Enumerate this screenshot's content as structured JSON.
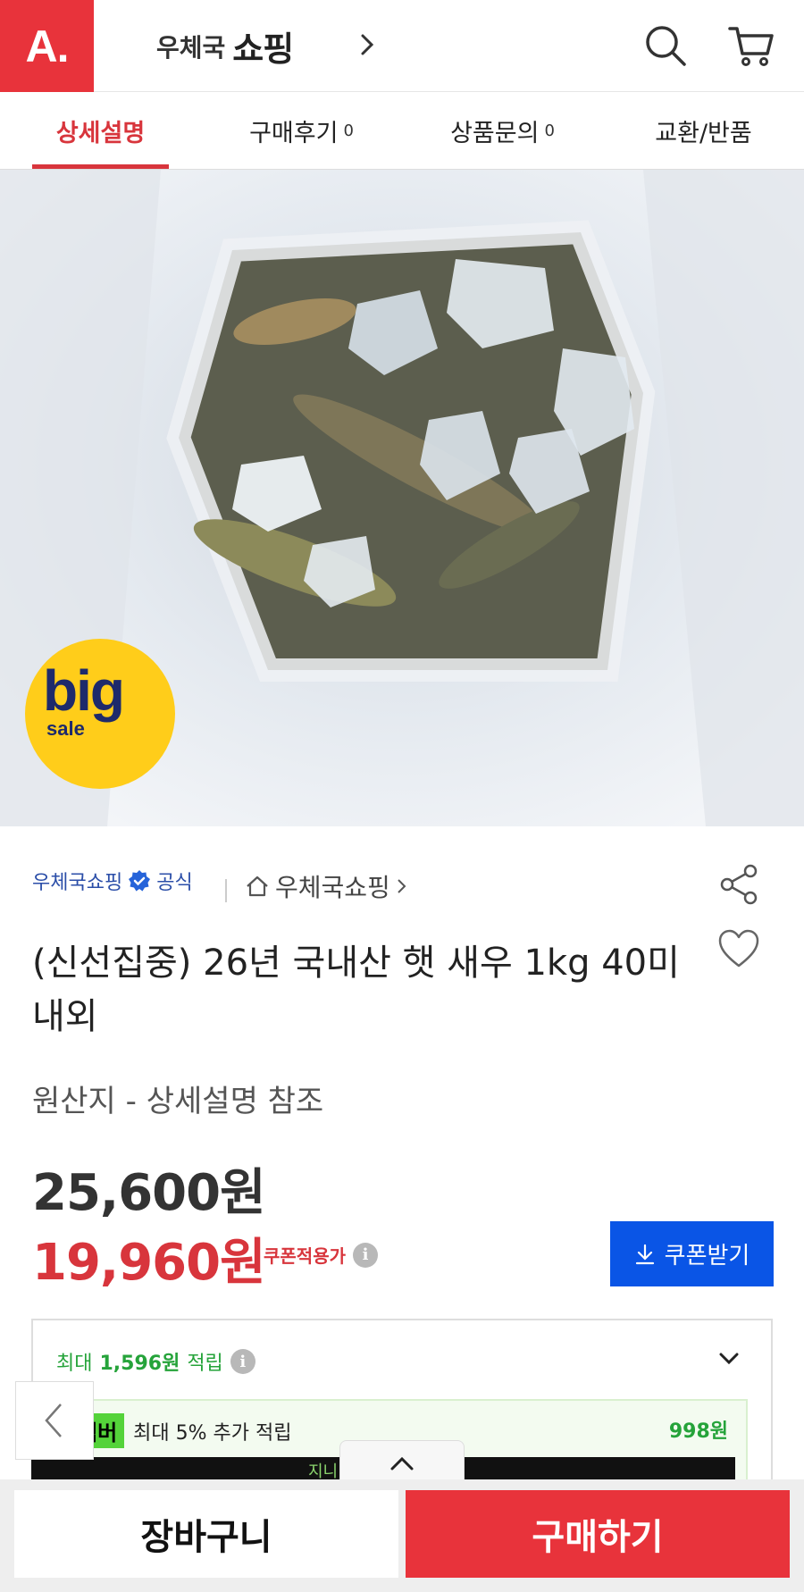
{
  "header": {
    "logo": "A.",
    "brand_small": "우체국",
    "brand_big": "쇼핑"
  },
  "tabs": [
    {
      "label": "상세설명",
      "count": ""
    },
    {
      "label": "구매후기",
      "count": "0"
    },
    {
      "label": "상품문의",
      "count": "0"
    },
    {
      "label": "교환/반품",
      "count": ""
    }
  ],
  "badge": {
    "big": "big",
    "sale": "sale"
  },
  "seller": {
    "name": "우체국쇼핑",
    "official": "공식",
    "store": "우체국쇼핑"
  },
  "product": {
    "title": "(신선집중) 26년 국내산 햇 새우 1kg 40미내외",
    "origin": "원산지 - 상세설명 참조",
    "price_original": "25,600원",
    "price_sale": "19,960원",
    "coupon_note": "쿠폰적용가",
    "coupon_button": "쿠폰받기"
  },
  "reward": {
    "prefix": "최대",
    "amount": "1,596원",
    "suffix": "적립",
    "member_tag": "멤버",
    "member_text": "최대 5% 추가 적립",
    "member_amount": "998원",
    "member_bar_text": "지니 시작 >"
  },
  "bottom": {
    "cart": "장바구니",
    "buy": "구매하기"
  },
  "colors": {
    "brand_red": "#e8333b",
    "coupon_blue": "#0a55e6",
    "reward_green": "#25a33a"
  }
}
